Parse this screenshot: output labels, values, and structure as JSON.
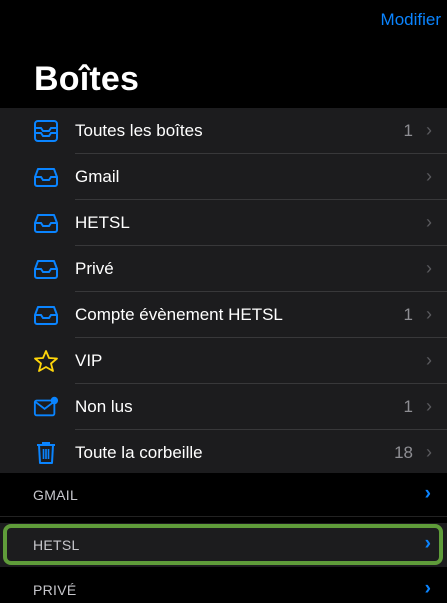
{
  "nav": {
    "edit_label": "Modifier"
  },
  "title": "Boîtes",
  "mailboxes": [
    {
      "label": "Toutes les boîtes",
      "count": "1",
      "icon": "all-inboxes-icon"
    },
    {
      "label": "Gmail",
      "count": "",
      "icon": "inbox-icon"
    },
    {
      "label": "HETSL",
      "count": "",
      "icon": "inbox-icon"
    },
    {
      "label": "Privé",
      "count": "",
      "icon": "inbox-icon"
    },
    {
      "label": "Compte évènement HETSL",
      "count": "1",
      "icon": "inbox-icon"
    },
    {
      "label": "VIP",
      "count": "",
      "icon": "star-icon"
    },
    {
      "label": "Non lus",
      "count": "1",
      "icon": "unread-envelope-icon"
    },
    {
      "label": "Toute la corbeille",
      "count": "18",
      "icon": "trash-icon"
    }
  ],
  "sections": [
    {
      "label": "GMAIL"
    },
    {
      "label": "HETSL"
    },
    {
      "label": "PRIVÉ"
    }
  ],
  "colors": {
    "accent": "#0a84ff",
    "highlight": "#5f9c3a",
    "row_bg": "#1c1c1e"
  }
}
